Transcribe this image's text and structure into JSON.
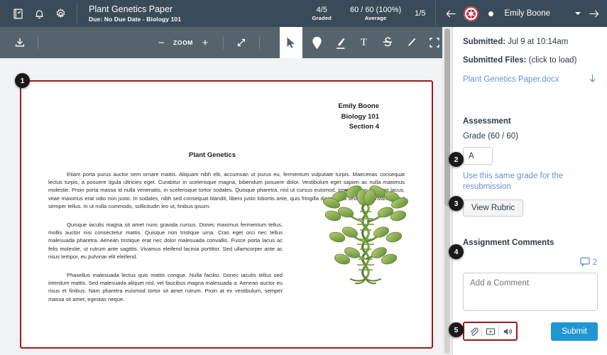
{
  "header": {
    "icons": [
      {
        "name": "courses-icon",
        "label": "Courses"
      },
      {
        "name": "notifications-bell-icon",
        "label": "Notifications"
      },
      {
        "name": "settings-gear-icon",
        "label": "Settings"
      }
    ],
    "title": "Plant Genetics Paper",
    "subtitle": "Due: No Due Date - Biology 101",
    "stats": [
      {
        "value": "4/5",
        "label": "Graded"
      },
      {
        "value": "60 / 60 (100%)",
        "label": "Average"
      }
    ],
    "position": "1/5",
    "prev_label": "←",
    "next_label": "→",
    "student_name": "Emily Boone",
    "avatar_name": "student-avatar"
  },
  "toolbar": {
    "download_label": "Download",
    "zoom_out_label": "−",
    "zoom_label": "ZOOM",
    "zoom_in_label": "+",
    "fullscreen_label": "Fullscreen",
    "tools": [
      {
        "name": "cursor-tool",
        "label": "Select",
        "selected": true
      },
      {
        "name": "point-annotation-tool",
        "label": "Point",
        "selected": false
      },
      {
        "name": "highlight-tool",
        "label": "Highlight",
        "selected": false
      },
      {
        "name": "text-annotation-tool",
        "label": "Text",
        "selected": false
      },
      {
        "name": "strikeout-tool",
        "label": "Strikeout",
        "selected": false
      },
      {
        "name": "freehand-draw-tool",
        "label": "Free Draw",
        "selected": false
      },
      {
        "name": "area-annotation-tool",
        "label": "Area",
        "selected": false
      }
    ]
  },
  "document": {
    "author": "Emily Boone",
    "course": "Biology 101",
    "section": "Section 4",
    "heading": "Plant Genetics",
    "paragraphs": [
      "Etiam porta purus auctor sem ornare mattis. Aliquam nibh elit, accumsan ut purus eu, fermentum vulputate turpis. Maecenas consequat lectus turpis, a posuere ligula ultricies eget. Curabitur in scelerisque magna, bibendum posuere dolor. Vestibulum eget sapien ac nulla maximus molestie. Proin porta massa id nulla venenatis, in scelerisque tortor sodales. Quisque pharetra, nisl ut cursus euismod, ipsum purus placerat lacus, vitae maximus erat odio non justo. In sodales, nibh sed consequat blandit, libero justo lobortis ante, quis fringilla diam ligula sed nunc. Vivamus sed semper tellus. In ut nulla commodo, sollicitudin leo ut, finibus ipsum.",
      "Quisque iaculis magna sit amet nunc gravida cursus. Donec maximus fermentum tellus, mollis auctor nisi consectetur mattis. Quisque non tristique urna. Cras eget orci nec tellus malesuada pharetra. Aenean tristique erat nec dolor malesuada convallis. Fusce porta lacus ac felis molestie, ut rutrum ante sagittis. Vivamus eleifend lacinia porttitor. Sed ullamcorper ante ac risus tempor, eu pulvinar elit eleifend.",
      "Phasellus malesuada lectus quis mattis congue. Nulla facilisi. Donec iaculis tellus sed interdum mattis. Sed malesuada aliquet nisl, vel faucibus magna malesuada a. Aenean auctor eu risus et finibus. Nam pharetra euismod tortor sit amet rutrum. Proin at ex vestibulum, semper massa sit amet, egestas neque."
    ],
    "image_name": "dna-plant-illustration"
  },
  "sidebar": {
    "submitted_label": "Submitted:",
    "submitted_value": "Jul 9 at 10:14am",
    "files_label": "Submitted Files:",
    "files_hint": "(click to load)",
    "file_link": "Plant Genetics Paper.docx",
    "assessment_title": "Assessment",
    "grade_line": "Grade (60 / 60)",
    "grade_value": "A",
    "grade_placeholder": "",
    "same_grade_link": "Use this same grade for the resubmission",
    "view_rubric_label": "View Rubric",
    "comments_title": "Assignment Comments",
    "comment_count": "2",
    "comment_placeholder": "Add a Comment",
    "comment_value": "",
    "attach_buttons": [
      {
        "name": "attach-file-icon",
        "label": "Attach File"
      },
      {
        "name": "record-video-icon",
        "label": "Record Video"
      },
      {
        "name": "record-audio-icon",
        "label": "Record Audio"
      }
    ],
    "submit_label": "Submit"
  },
  "badges": [
    {
      "n": "1",
      "target": "document-page"
    },
    {
      "n": "2",
      "target": "grade-input"
    },
    {
      "n": "3",
      "target": "view-rubric-button"
    },
    {
      "n": "4",
      "target": "assignment-comments-title"
    },
    {
      "n": "5",
      "target": "comment-attachment-buttons"
    }
  ],
  "colors": {
    "header_bg": "#394B58",
    "toolbar_bg": "#55636D",
    "accent_red": "#9E1B1B",
    "link_blue": "#6A93CB",
    "submit_blue": "#2196D4"
  }
}
